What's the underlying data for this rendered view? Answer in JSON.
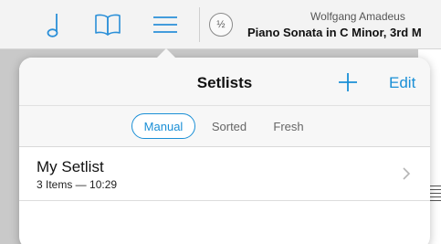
{
  "toolbar": {
    "icons": [
      "note-icon",
      "book-icon",
      "list-icon"
    ],
    "half_label": "½",
    "composer": "Wolfgang Amadeus",
    "piece_title": "Piano Sonata in C Minor, 3rd M"
  },
  "popover": {
    "title": "Setlists",
    "add_icon": "plus-icon",
    "edit_label": "Edit",
    "segments": [
      {
        "label": "Manual",
        "active": true
      },
      {
        "label": "Sorted",
        "active": false
      },
      {
        "label": "Fresh",
        "active": false
      }
    ]
  },
  "setlists": [
    {
      "name": "My Setlist",
      "detail": "3 Items — 10:29"
    }
  ],
  "colors": {
    "accent": "#1a8fd6",
    "icon_blue": "#2a8fd8",
    "toolbar_bg": "#f3f3f3",
    "popover_header_bg": "#f7f7f7"
  }
}
